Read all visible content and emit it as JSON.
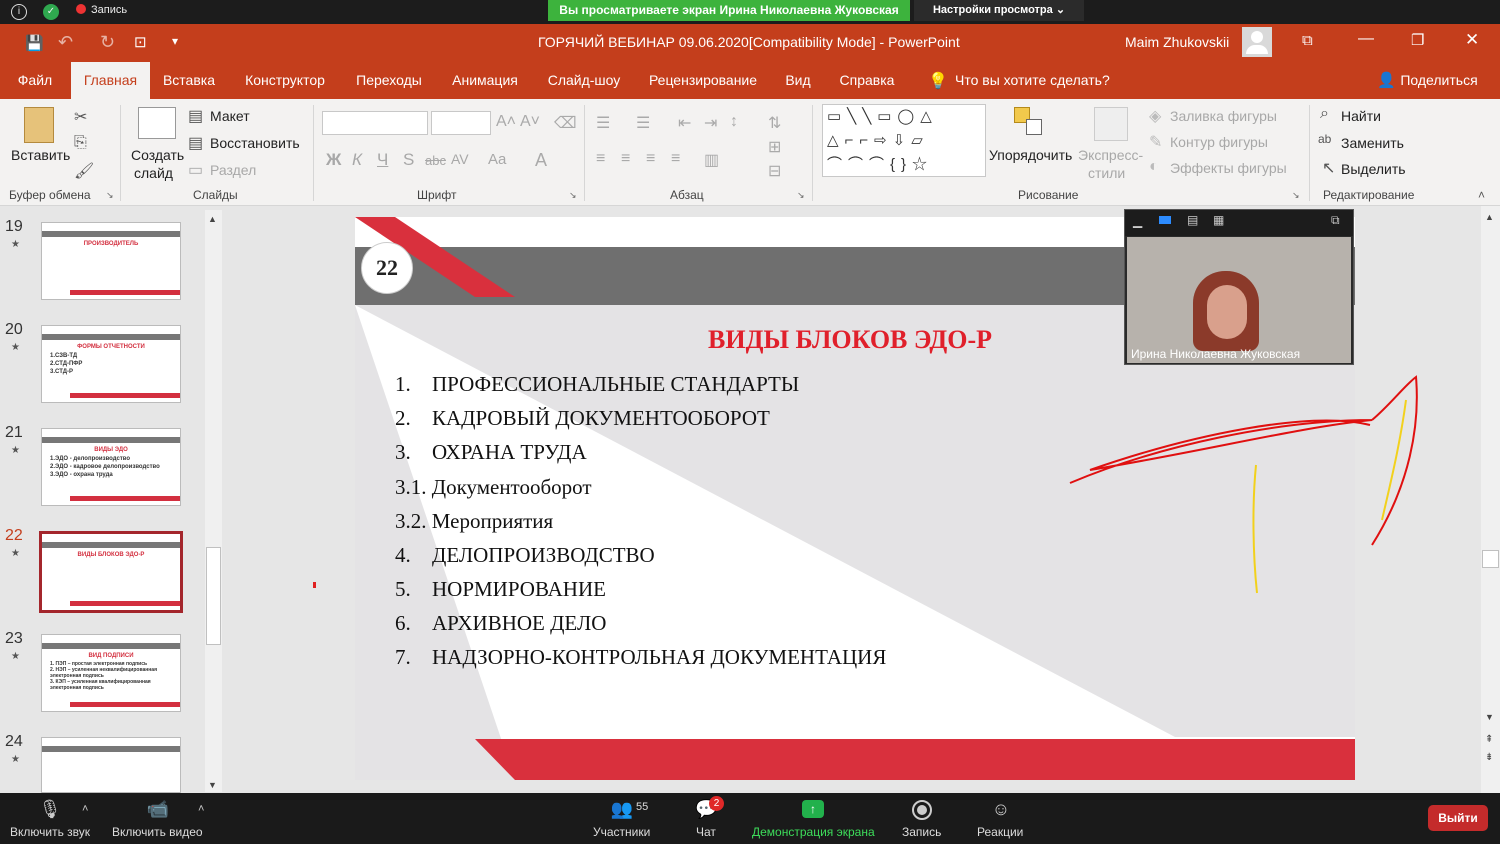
{
  "zoom_top": {
    "recording_label": "Запись",
    "share_banner": "Вы просматриваете экран Ирина Николаевна Жуковская",
    "view_options": "Настройки просмотра ⌄"
  },
  "window": {
    "title": "ГОРЯЧИЙ ВЕБИНАР 09.06.2020[Compatibility Mode]  -  PowerPoint",
    "user": "Maim Zhukovskii"
  },
  "tabs": [
    "Файл",
    "Главная",
    "Вставка",
    "Конструктор",
    "Переходы",
    "Анимация",
    "Слайд-шоу",
    "Рецензирование",
    "Вид",
    "Справка"
  ],
  "tell_me": "Что вы хотите сделать?",
  "share": "Поделиться",
  "ribbon": {
    "paste": "Вставить",
    "clipboard_group": "Буфер обмена",
    "new_slide_1": "Создать",
    "new_slide_2": "слайд",
    "layout": "Макет",
    "reset": "Восстановить",
    "section": "Раздел",
    "slides_group": "Слайды",
    "font_group": "Шрифт",
    "bold": "Ж",
    "italic": "К",
    "underline": "Ч",
    "strike": "S",
    "abc": "abc",
    "spacing": "AV",
    "case": "Aa",
    "paragraph_group": "Абзац",
    "arrange": "Упорядочить",
    "quick_styles_1": "Экспресс-",
    "quick_styles_2": "стили",
    "shape_fill": "Заливка фигуры",
    "shape_outline": "Контур фигуры",
    "shape_effects": "Эффекты фигуры",
    "drawing_group": "Рисование",
    "find": "Найти",
    "replace": "Заменить",
    "select": "Выделить",
    "editing_group": "Редактирование"
  },
  "thumbnails": [
    {
      "num": "19",
      "title": "ПРОИЗВОДИТЕЛЬ",
      "lines": ""
    },
    {
      "num": "20",
      "title": "ФОРМЫ ОТЧЕТНОСТИ",
      "lines": "1.СЗВ-ТД\n2.СТД-ПФР\n3.СТД-Р"
    },
    {
      "num": "21",
      "title": "ВИДЫ ЭДО",
      "lines": "1.ЭДО - делопроизводство\n2.ЭДО - кадровое делопроизводство\n3.ЭДО - охрана труда"
    },
    {
      "num": "22",
      "title": "ВИДЫ БЛОКОВ ЭДО-Р",
      "lines": ""
    },
    {
      "num": "23",
      "title": "ВИД ПОДПИСИ",
      "lines": "1. ПЭП – простая электронная подпись\n2. НЭП – усиленная неквалифицированная\nэлектронная подпись\n3. КЭП – усиленная квалифицированная\nэлектронная подпись"
    },
    {
      "num": "24",
      "title": "",
      "lines": ""
    }
  ],
  "slide": {
    "number": "22",
    "title": "ВИДЫ БЛОКОВ ЭДО-Р",
    "items": [
      {
        "n": "1.",
        "text": "ПРОФЕССИОНАЛЬНЫЕ СТАНДАРТЫ"
      },
      {
        "n": "2.",
        "text": "КАДРОВЫЙ ДОКУМЕНТООБОРОТ"
      },
      {
        "n": "3.",
        "text": "ОХРАНА ТРУДА"
      },
      {
        "n": "3.1.",
        "text": "Документооборот"
      },
      {
        "n": "3.2.",
        "text": "Мероприятия"
      },
      {
        "n": "4.",
        "text": "ДЕЛОПРОИЗВОДСТВО"
      },
      {
        "n": "5.",
        "text": "НОРМИРОВАНИЕ"
      },
      {
        "n": "6.",
        "text": "АРХИВНОЕ ДЕЛО"
      },
      {
        "n": "7.",
        "text": "НАДЗОРНО-КОНТРОЛЬНАЯ ДОКУМЕНТАЦИЯ"
      }
    ]
  },
  "video": {
    "name": "Ирина Николаевна Жуковская"
  },
  "controls": {
    "mute": "Включить звук",
    "video": "Включить видео",
    "participants": "Участники",
    "participants_count": "55",
    "chat": "Чат",
    "chat_badge": "2",
    "share_screen": "Демонстрация экрана",
    "record": "Запись",
    "reactions": "Реакции",
    "leave": "Выйти"
  }
}
